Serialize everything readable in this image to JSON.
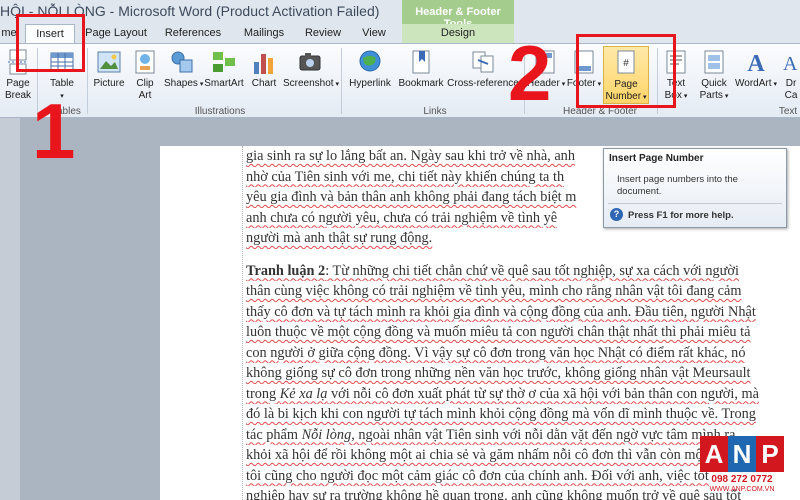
{
  "title": {
    "doc_title": "HỘI - NỖI LÒNG  -  Microsoft Word (Product Activation Failed)",
    "contextual_tab": "Header & Footer Tools"
  },
  "tabs": [
    {
      "label": "me"
    },
    {
      "label": "Insert"
    },
    {
      "label": "Page Layout"
    },
    {
      "label": "References"
    },
    {
      "label": "Mailings"
    },
    {
      "label": "Review"
    },
    {
      "label": "View"
    },
    {
      "label": "Design"
    }
  ],
  "ribbon": {
    "pages": {
      "page_break_1": "Page",
      "page_break_2": "Break",
      "group": "Pages"
    },
    "tables": {
      "table": "Table",
      "group": "Tables"
    },
    "illustrations": {
      "picture": "Picture",
      "clip_art_1": "Clip",
      "clip_art_2": "Art",
      "shapes": "Shapes",
      "smartart": "SmartArt",
      "chart": "Chart",
      "screenshot": "Screenshot",
      "group": "Illustrations"
    },
    "links": {
      "hyperlink": "Hyperlink",
      "bookmark": "Bookmark",
      "cross_reference": "Cross-reference",
      "group": "Links"
    },
    "header_footer": {
      "header": "Header",
      "footer": "Footer",
      "page_number_1": "Page",
      "page_number_2": "Number",
      "group": "Header & Footer"
    },
    "text": {
      "text_box_1": "Text",
      "text_box_2": "Box",
      "quick_parts_1": "Quick",
      "quick_parts_2": "Parts",
      "wordart": "WordArt",
      "drop_cap_1": "Dr",
      "drop_cap_2": "Ca",
      "group": "Text"
    }
  },
  "callouts": {
    "one": "1",
    "two": "2"
  },
  "tooltip": {
    "title": "Insert Page Number",
    "description": "Insert page numbers into the document.",
    "help": "Press F1 for more help."
  },
  "document": {
    "para1": [
      "gia sinh ra sự lo lắng bất an. Ngày sau khi trở về nhà, anh",
      "nhờ của Tiên sinh với me, chi tiết này khiến chúng ta th",
      "yêu gia đình và bản thân anh không phải đang tách biệt m",
      "anh chưa có người yêu, chưa có trải nghiệm về tình yê",
      "người mà anh thật sự rung động."
    ],
    "para2_lead": "Tranh luận 2",
    "para2_first": ": Từ những chi tiết chẳn chứ về quê sau tốt nghiệp, sự xa cách với người",
    "para2_lines": [
      "thân cùng việc không có trải nghiệm về tình yêu, mình cho rằng nhân vật tôi đang cảm",
      "thấy cô đơn và tự tách mình ra khỏi gia đình và cộng đồng của anh. Đầu tiên, người Nhật",
      "luôn thuộc về một cộng đồng và muốn miêu tả con người chân thật nhất thì phải miêu tả",
      "con người ở giữa cộng đồng. Vì vậy sự cô đơn trong văn học Nhật có điểm rất khác, nó",
      "không giống sự cô đơn trong những nền văn học trước, không giống nhân vật Meursault"
    ],
    "para2_kexala_pre": "trong ",
    "para2_kexala": "Kẻ xa lạ",
    "para2_kexala_post": " với nỗi cô đơn xuất phát từ sự thờ ơ của xã hội với bản thân con người, mà",
    "para2_line8": "đó là bi kịch khi con người tự tách mình khỏi cộng đồng mà vốn dĩ mình thuộc về. Trong",
    "para2_noilong_pre": "tác phẩm ",
    "para2_noilong": "Nỗi lòng",
    "para2_noilong_post": ", ngoài nhân vật Tiên sinh với nỗi dằn vặt đến ngờ vực tâm mình ra",
    "para2_tail": [
      "khỏi xã hội để rồi không một ai chia sẻ và găm nhấm nỗi cô đơn thì vẫn còn một nhân vật",
      "tôi cũng cho người đọc một cảm giác cô đơn của chính anh. Đối với anh, việc tốt",
      "nghiệp hay sự ra trường không hề quan trọng, anh cũng không muốn trở về quê sau tốt"
    ]
  },
  "watermark": {
    "letters": [
      "A",
      "N",
      "P"
    ],
    "phone": "098 272 0772",
    "url": "WWW.ANP.COM.VN",
    "colors": [
      "#d2171e",
      "#1f67b1",
      "#d2171e"
    ]
  }
}
